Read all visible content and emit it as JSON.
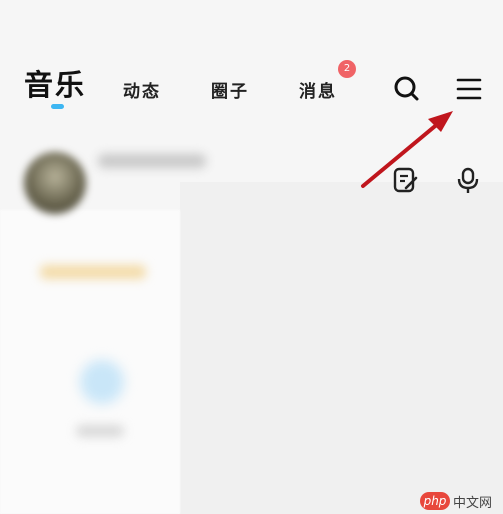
{
  "nav": {
    "tabs": [
      {
        "label": "音乐",
        "active": true
      },
      {
        "label": "动态",
        "active": false
      },
      {
        "label": "圈子",
        "active": false
      },
      {
        "label": "消息",
        "active": false,
        "badge": "2"
      }
    ],
    "icons": [
      "search-icon",
      "menu-icon"
    ],
    "indicator_color": "#3db6f2",
    "badge_color": "#f06366"
  },
  "profile": {
    "icons": [
      "edit-icon",
      "microphone-icon"
    ]
  },
  "annotation": {
    "arrow_color": "#c0161d",
    "points_to": "menu-icon"
  },
  "watermark": {
    "logo": "php",
    "text": "中文网"
  }
}
